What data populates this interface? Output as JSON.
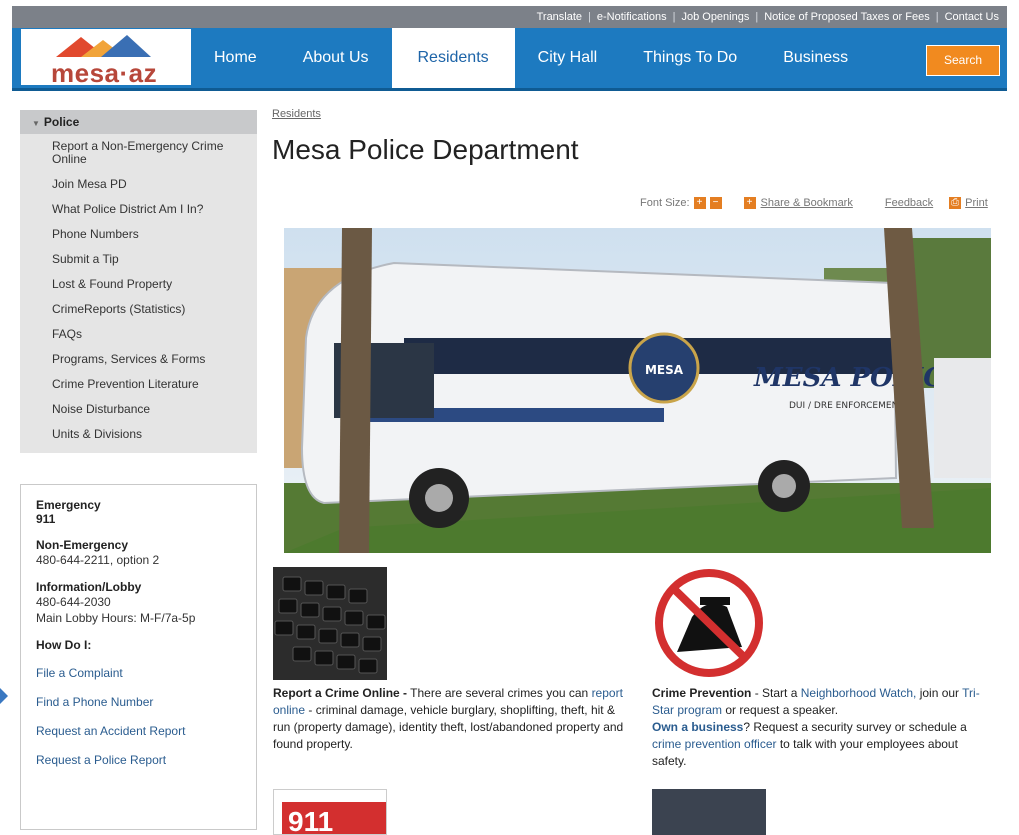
{
  "utility_links": [
    "Translate",
    "e-Notifications",
    "Job Openings",
    "Notice of Proposed Taxes or Fees",
    "Contact Us"
  ],
  "logo_text": "mesa·az",
  "nav": {
    "items": [
      "Home",
      "About Us",
      "Residents",
      "City Hall",
      "Things To Do",
      "Business"
    ],
    "active": "Residents",
    "search_label": "Search"
  },
  "sidebar": {
    "heading": "Police",
    "items": [
      "Report a Non-Emergency Crime Online",
      "Join Mesa PD",
      "What Police District Am I In?",
      "Phone Numbers",
      "Submit a Tip",
      "Lost & Found Property",
      "CrimeReports (Statistics)",
      "FAQs",
      "Programs, Services & Forms",
      "Crime Prevention Literature",
      "Noise Disturbance",
      "Units & Divisions"
    ]
  },
  "contact": {
    "emergency_label": "Emergency",
    "emergency_number": "911",
    "nonemergency_label": "Non-Emergency",
    "nonemergency_number": "480-644-2211, option 2",
    "info_label": "Information/Lobby",
    "info_number": "480-644-2030",
    "info_hours": "Main Lobby Hours: M-F/7a-5p",
    "how_label": "How Do I:",
    "links": [
      "File a Complaint",
      "Find a Phone Number",
      "Request an Accident Report",
      "Request a Police Report"
    ]
  },
  "breadcrumb": "Residents",
  "page_title": "Mesa Police Department",
  "tools": {
    "font_size_label": "Font Size:",
    "share_label": "Share & Bookmark",
    "feedback_label": "Feedback",
    "print_label": "Print"
  },
  "hero": {
    "vehicle_text": "MESA POLICE",
    "vehicle_subtext": "DUI / DRE ENFORCEMENT",
    "badge_text": "MESA"
  },
  "feature1": {
    "title": "Report a Crime Online -",
    "text1": " There are several crimes you can ",
    "link": "report online",
    "text2": " - criminal damage, vehicle burglary, shoplifting, theft, hit & run (property damage), identity theft, lost/abandoned property and found property."
  },
  "feature2": {
    "title": "Crime Prevention",
    "text1": " - Start a ",
    "link1": "Neighborhood Watch,",
    "text2": " join our ",
    "link2": "Tri-Star program",
    "text3": " or request a speaker.",
    "link3": "Own a business",
    "text4": "? Request a security survey or schedule a ",
    "link4": "crime prevention officer",
    "text5": " to talk with your employees about safety."
  },
  "bottom_thumb_text": "911",
  "colors": {
    "nav_blue": "#1d7ac0",
    "search_orange": "#f18a1f",
    "link_blue": "#2a5c8f"
  }
}
